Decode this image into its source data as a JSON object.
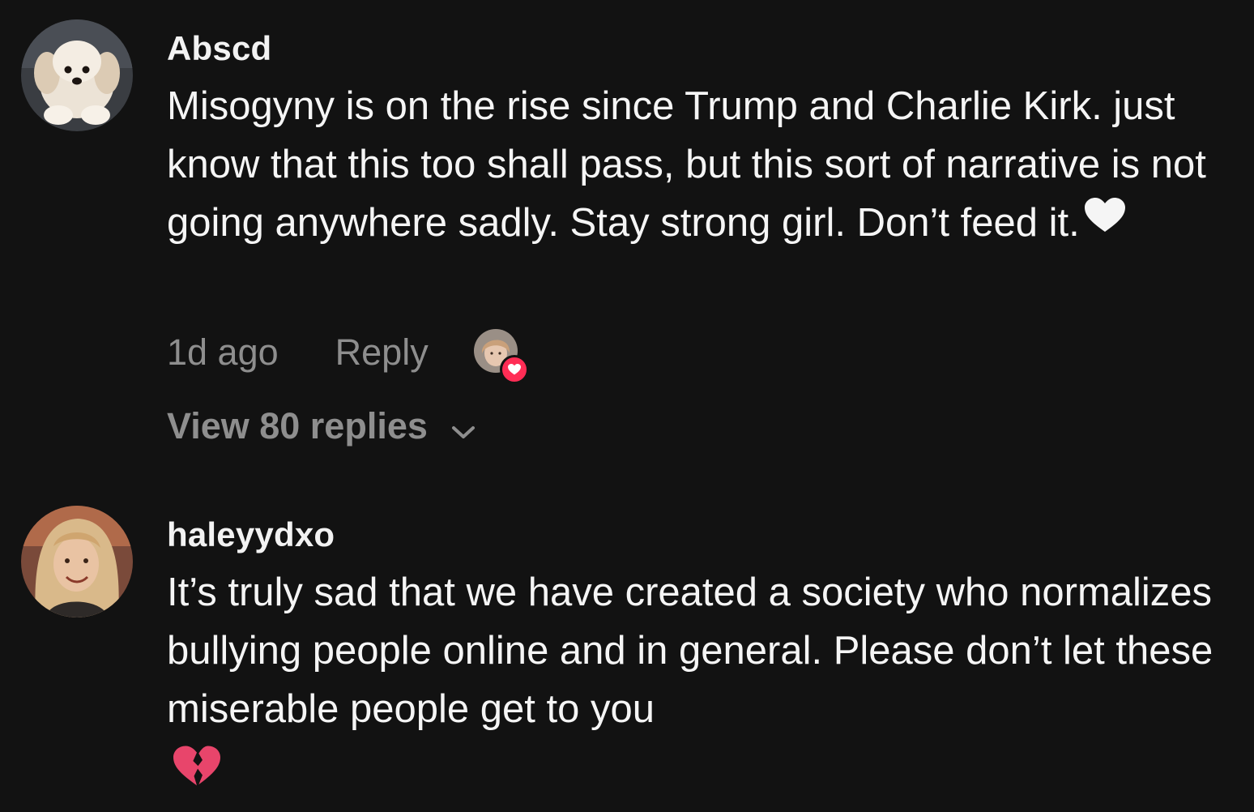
{
  "comments": [
    {
      "username": "Abscd",
      "text": "Misogyny is on the rise since Trump and Charlie Kirk. just know that this too shall pass, but this sort of narrative is not going anywhere sadly. Stay strong girl. Don’t feed it.",
      "emoji_icon": "white-heart-icon",
      "time": "1d ago",
      "reply_label": "Reply",
      "view_replies_label": "View 80 replies",
      "liked_by_creator": true
    },
    {
      "username": "haleyydxo",
      "text": "It’s truly sad that we have created a society who normalizes bullying people online and in general. Please don’t let these miserable people get to you",
      "emoji_icon": "broken-heart-icon"
    }
  ],
  "colors": {
    "background": "#121212",
    "primary_text": "#f5f5f5",
    "secondary_text": "#8e8e8e",
    "like_badge": "#ff2d55",
    "broken_heart": "#e8456b"
  }
}
